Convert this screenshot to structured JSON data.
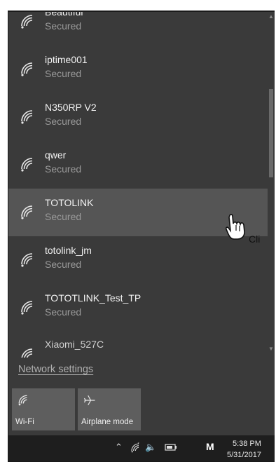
{
  "networks": [
    {
      "name": "Beautiful",
      "status": "Secured"
    },
    {
      "name": "iptime001",
      "status": "Secured"
    },
    {
      "name": "N350RP V2",
      "status": "Secured"
    },
    {
      "name": "qwer",
      "status": "Secured"
    },
    {
      "name": "TOTOLINK",
      "status": "Secured"
    },
    {
      "name": "totolink_jm",
      "status": "Secured"
    },
    {
      "name": "TOTOTLINK_Test_TP",
      "status": "Secured"
    },
    {
      "name": "Xiaomi_527C",
      "status": ""
    }
  ],
  "selected_network": "TOTOLINK",
  "network_settings_label": "Network settings",
  "tiles": {
    "wifi_label": "Wi-Fi",
    "airplane_label": "Airplane mode"
  },
  "taskbar": {
    "ime_indicator": "M",
    "time": "5:38 PM",
    "date": "5/31/2017"
  },
  "cursor_text": "Cli",
  "colors": {
    "panel_bg": "#3a3a3a",
    "selected_bg": "#555555",
    "tile_bg": "#5e5e5e",
    "taskbar_bg": "#1e1e1e"
  }
}
